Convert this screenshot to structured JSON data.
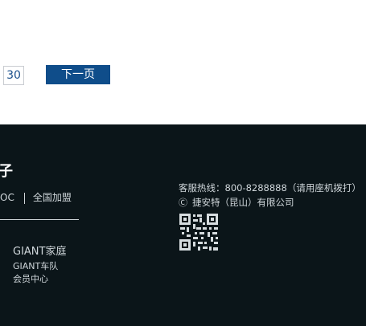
{
  "pagination": {
    "page_number": "30",
    "next_label": "下一页"
  },
  "footer": {
    "heading": "子",
    "links": [
      "OC",
      "全国加盟"
    ],
    "giant_links": [
      "GIANT家庭",
      "GIANT车队",
      "会员中心"
    ],
    "hotline": "客服热线：800-8288888（请用座机拨打）",
    "copyright_symbol": "Ⓒ",
    "company": "捷安特（昆山）有限公司",
    "qr_icon": "qr-code-icon"
  },
  "colors": {
    "accent": "#0f4d8a",
    "footer_bg": "#0b1519",
    "footer_text": "#cfd6da"
  }
}
